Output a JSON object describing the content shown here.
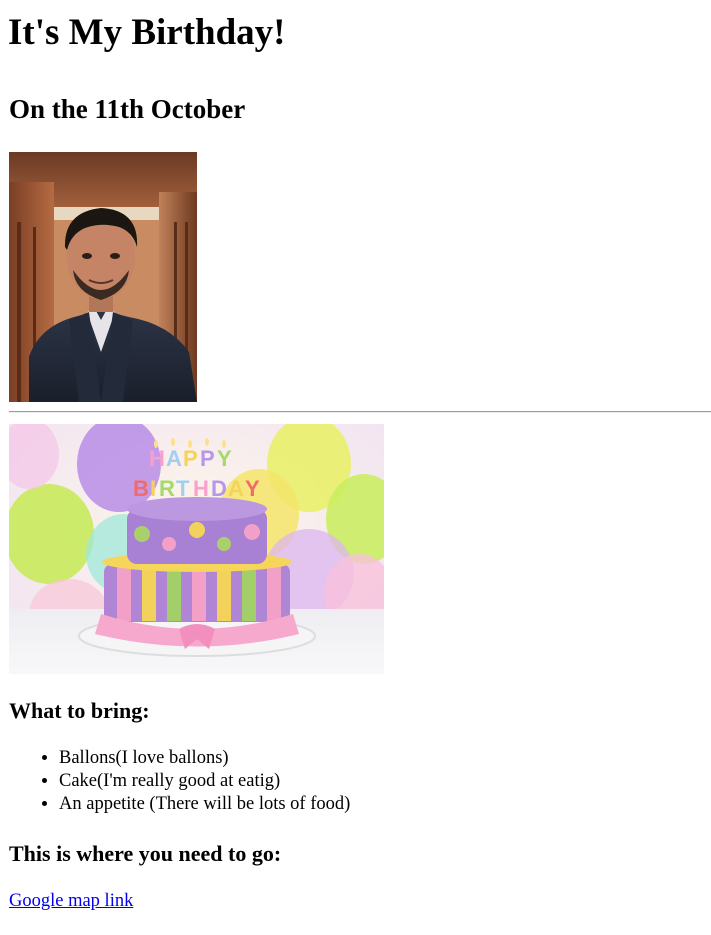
{
  "header": {
    "title": "It's My Birthday!",
    "subtitle": "On the 11th October"
  },
  "images": {
    "portrait_icon": "portrait-photo",
    "cake_icon": "birthday-cake-photo",
    "cake_candles_text": "HAPPY BIRTHDAY"
  },
  "bring": {
    "title": "What to bring:",
    "items": [
      "Ballons(I love ballons)",
      "Cake(I'm really good at eatig)",
      "An appetite (There will be lots of food)"
    ]
  },
  "location": {
    "title": "This is where you need to go:",
    "link_text": "Google map link"
  },
  "colors": {
    "link": "#0000ee",
    "text": "#000000"
  }
}
